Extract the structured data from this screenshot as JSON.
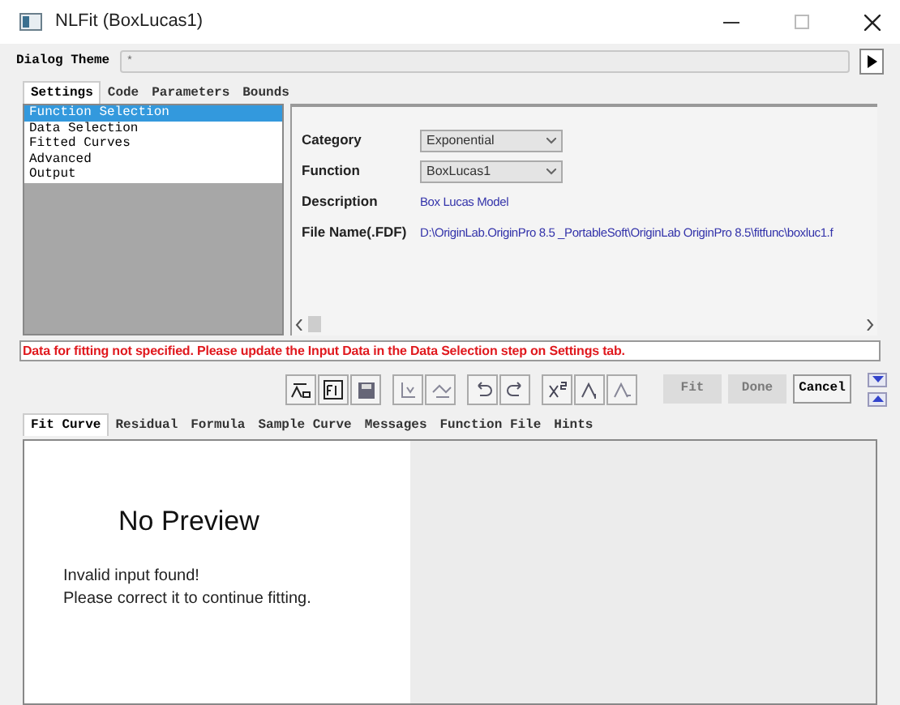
{
  "window": {
    "title": "NLFit (BoxLucas1)"
  },
  "dialog_theme": {
    "label": "Dialog Theme",
    "value": "*"
  },
  "tabs": [
    {
      "label": "Settings",
      "selected": true
    },
    {
      "label": "Code",
      "selected": false
    },
    {
      "label": "Parameters",
      "selected": false
    },
    {
      "label": "Bounds",
      "selected": false
    }
  ],
  "tree": {
    "items": [
      {
        "label": "Function Selection",
        "selected": true
      },
      {
        "label": "Data Selection",
        "selected": false
      },
      {
        "label": "Fitted Curves",
        "selected": false
      },
      {
        "label": "Advanced",
        "selected": false
      },
      {
        "label": "Output",
        "selected": false
      }
    ]
  },
  "settings": {
    "rows": [
      {
        "kind": "dropdown",
        "label": "Category",
        "value": "Exponential"
      },
      {
        "kind": "dropdown",
        "label": "Function",
        "value": "BoxLucas1"
      },
      {
        "kind": "link",
        "label": "Description",
        "value": "Box Lucas Model"
      },
      {
        "kind": "link",
        "label": "File Name(.FDF)",
        "value": "D:\\OriginLab.OriginPro 8.5 _PortableSoft\\OriginLab OriginPro 8.5\\fitfunc\\boxluc1.f"
      }
    ]
  },
  "message": "Data for fitting not specified. Please update the Input Data in the Data Selection step on Settings tab.",
  "buttons": [
    {
      "label": "Fit",
      "disabled": true
    },
    {
      "label": "Done",
      "disabled": true
    },
    {
      "label": "Cancel",
      "disabled": false
    }
  ],
  "preview_tabs": [
    {
      "label": "Fit Curve",
      "selected": true
    },
    {
      "label": "Residual",
      "selected": false
    },
    {
      "label": "Formula",
      "selected": false
    },
    {
      "label": "Sample Curve",
      "selected": false
    },
    {
      "label": "Messages",
      "selected": false
    },
    {
      "label": "Function File",
      "selected": false
    },
    {
      "label": "Hints",
      "selected": false
    }
  ],
  "preview": {
    "title": "No Preview",
    "lines": [
      "Invalid input found!",
      "Please correct it to continue fitting."
    ]
  }
}
